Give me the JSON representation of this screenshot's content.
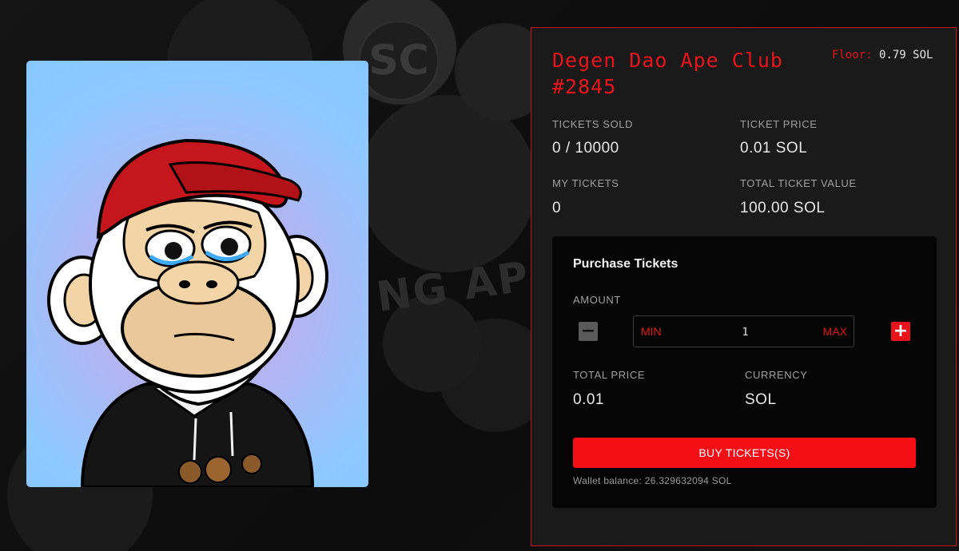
{
  "backdrop": {
    "logo_text": "SC",
    "banner_text": "NG APES G"
  },
  "nft": {
    "alt": "Degen Dao Ape Club #2845 artwork"
  },
  "raffle": {
    "title": "Degen Dao Ape Club #2845",
    "floor_label": "Floor:",
    "floor_value": "0.79 SOL",
    "tickets_sold_label": "TICKETS SOLD",
    "tickets_sold_value": "0 / 10000",
    "ticket_price_label": "TICKET PRICE",
    "ticket_price_value": "0.01 SOL",
    "my_tickets_label": "MY TICKETS",
    "my_tickets_value": "0",
    "total_value_label": "TOTAL TICKET VALUE",
    "total_value_value": "100.00 SOL"
  },
  "purchase": {
    "title": "Purchase Tickets",
    "amount_label": "AMOUNT",
    "minus_symbol": "−",
    "plus_symbol": "+",
    "min_label": "MIN",
    "max_label": "MAX",
    "amount_value": "1",
    "total_price_label": "TOTAL PRICE",
    "total_price_value": "0.01",
    "currency_label": "CURRENCY",
    "currency_value": "SOL",
    "buy_label": "BUY TICKETS(S)",
    "wallet_balance": "Wallet balance: 26.329632094 SOL"
  },
  "colors": {
    "accent": "#e8141c",
    "panel_bg": "#1a1a1a",
    "purchase_bg": "#050505"
  }
}
